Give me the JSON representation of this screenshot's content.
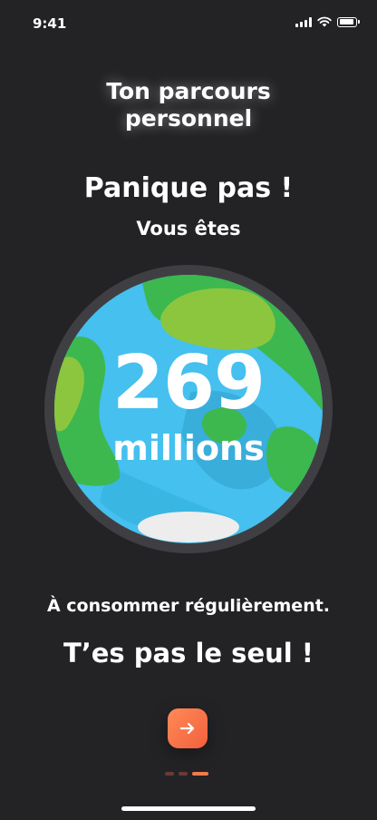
{
  "status_bar": {
    "time": "9:41",
    "icons": [
      "signal-icon",
      "wifi-icon",
      "battery-icon"
    ]
  },
  "screen": {
    "title_line1": "Ton parcours",
    "title_line2": "personnel",
    "headline": "Panique pas !",
    "subhead": "Vous êtes",
    "count_number": "269",
    "count_unit": "millions",
    "body_text": "À consommer régulièrement.",
    "closing_text": "T’es pas le seul !"
  },
  "next_button": {
    "icon": "arrow-right-icon",
    "color_start": "#ff8a57",
    "color_end": "#f2603d"
  },
  "pagination": {
    "total": 3,
    "current": 3,
    "active_color": "#f47a4a",
    "inactive_color": "#6b3a36"
  },
  "colors": {
    "background": "#232326",
    "globe_ring": "#3f3f43",
    "ocean": "#45c0ef",
    "land": "#3cb84f",
    "land_light": "#8cc63f"
  }
}
